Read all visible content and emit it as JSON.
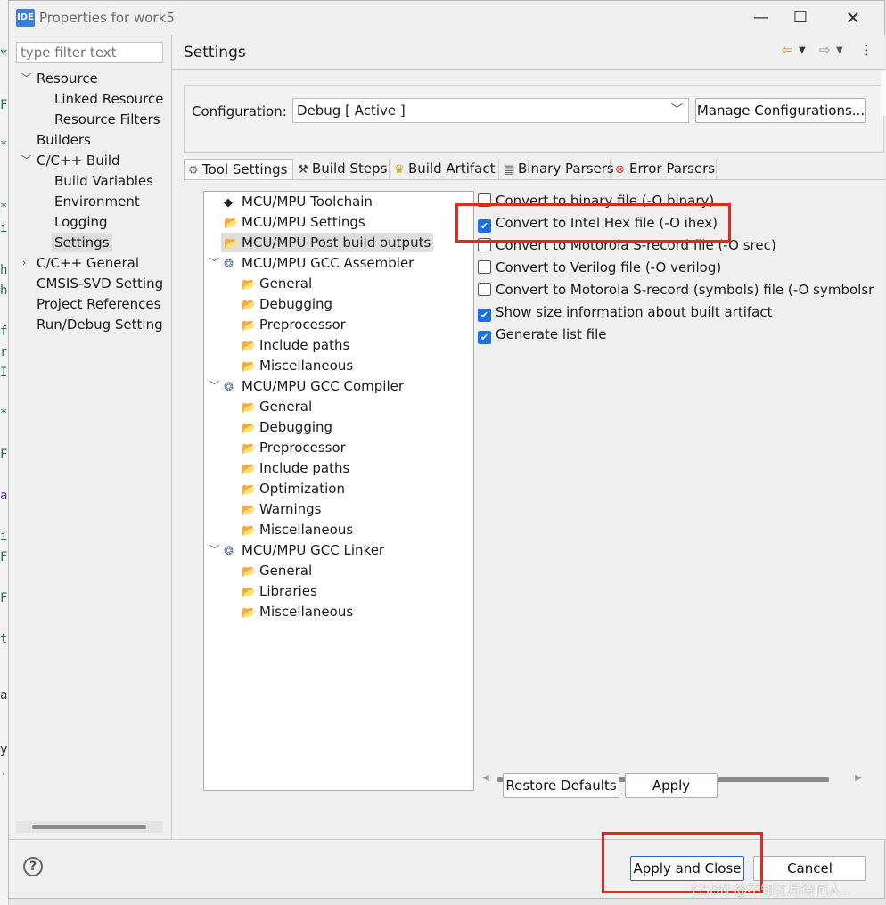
{
  "window": {
    "title": "Properties for work5",
    "app_icon": "IDE"
  },
  "left": {
    "filter_placeholder": "type filter text",
    "items": [
      {
        "label": "Resource",
        "expanded": true
      },
      {
        "label": "Linked Resource"
      },
      {
        "label": "Resource Filters"
      },
      {
        "label": "Builders"
      },
      {
        "label": "C/C++ Build",
        "expanded": true
      },
      {
        "label": "Build Variables"
      },
      {
        "label": "Environment"
      },
      {
        "label": "Logging"
      },
      {
        "label": "Settings",
        "selected": true
      },
      {
        "label": "C/C++ General",
        "expanded": false
      },
      {
        "label": "CMSIS-SVD Setting"
      },
      {
        "label": "Project References"
      },
      {
        "label": "Run/Debug Setting"
      }
    ]
  },
  "main": {
    "title": "Settings",
    "configuration_label": "Configuration:",
    "configuration_value": "Debug  [ Active ]",
    "manage_button": "Manage Configurations...",
    "tabs": [
      {
        "label": "Tool Settings",
        "icon": "tool-settings-icon",
        "active": true
      },
      {
        "label": "Build Steps",
        "icon": "build-steps-icon"
      },
      {
        "label": "Build Artifact",
        "icon": "trophy-icon"
      },
      {
        "label": "Binary Parsers",
        "icon": "binary-icon"
      },
      {
        "label": "Error Parsers",
        "icon": "error-icon"
      }
    ],
    "tool_tree": [
      {
        "label": "MCU/MPU Toolchain"
      },
      {
        "label": "MCU/MPU Settings"
      },
      {
        "label": "MCU/MPU Post build outputs",
        "selected": true
      },
      {
        "label": "MCU/MPU GCC Assembler",
        "expanded": true
      },
      {
        "label": "General"
      },
      {
        "label": "Debugging"
      },
      {
        "label": "Preprocessor"
      },
      {
        "label": "Include paths"
      },
      {
        "label": "Miscellaneous"
      },
      {
        "label": "MCU/MPU GCC Compiler",
        "expanded": true
      },
      {
        "label": "General"
      },
      {
        "label": "Debugging"
      },
      {
        "label": "Preprocessor"
      },
      {
        "label": "Include paths"
      },
      {
        "label": "Optimization"
      },
      {
        "label": "Warnings"
      },
      {
        "label": "Miscellaneous"
      },
      {
        "label": "MCU/MPU GCC Linker",
        "expanded": true
      },
      {
        "label": "General"
      },
      {
        "label": "Libraries"
      },
      {
        "label": "Miscellaneous"
      }
    ],
    "options": [
      {
        "label": "Convert to binary file (-O binary)",
        "checked": false
      },
      {
        "label": "Convert to Intel Hex file (-O ihex)",
        "checked": true
      },
      {
        "label": "Convert to Motorola S-record file (-O srec)",
        "checked": false
      },
      {
        "label": "Convert to Verilog file (-O verilog)",
        "checked": false
      },
      {
        "label": "Convert to Motorola S-record (symbols) file (-O symbolsr",
        "checked": false
      },
      {
        "label": "Show size information about built artifact",
        "checked": true
      },
      {
        "label": "Generate list file",
        "checked": true
      }
    ],
    "restore_button": "Restore Defaults",
    "apply_button": "Apply"
  },
  "footer": {
    "apply_close_button": "Apply and Close",
    "cancel_button": "Cancel",
    "watermark": "CSDN @不知江月待何人.."
  },
  "colors": {
    "accent": "#1f6fe0",
    "highlight": "#e8251f"
  }
}
